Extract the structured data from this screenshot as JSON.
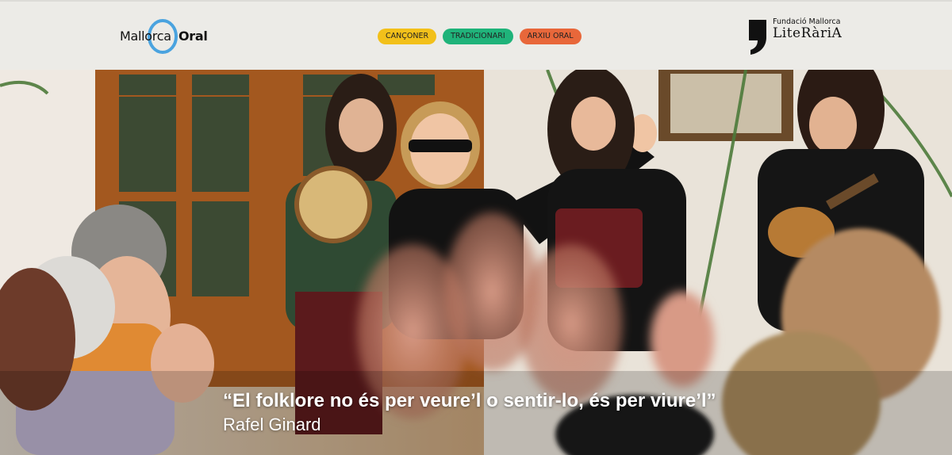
{
  "header": {
    "logo_left": {
      "word1": "Mallorca",
      "word2": "Oral",
      "ring_color": "#4aa3df"
    },
    "nav": [
      {
        "label": "CANÇONER",
        "color": "#f2c01a"
      },
      {
        "label": "TRADICIONARI",
        "color": "#1fb37a"
      },
      {
        "label": "ARXIU ORAL",
        "color": "#e8673a"
      }
    ],
    "logo_right": {
      "line1": "Fundació Mallorca",
      "line2": "LiteRàriA"
    }
  },
  "hero": {
    "image": "photo-folk-singers-performing-audience-clapping",
    "quote": "“El folklore no és per veure’l o sentir-lo, és per viure’l”",
    "author": "Rafel Ginard"
  }
}
